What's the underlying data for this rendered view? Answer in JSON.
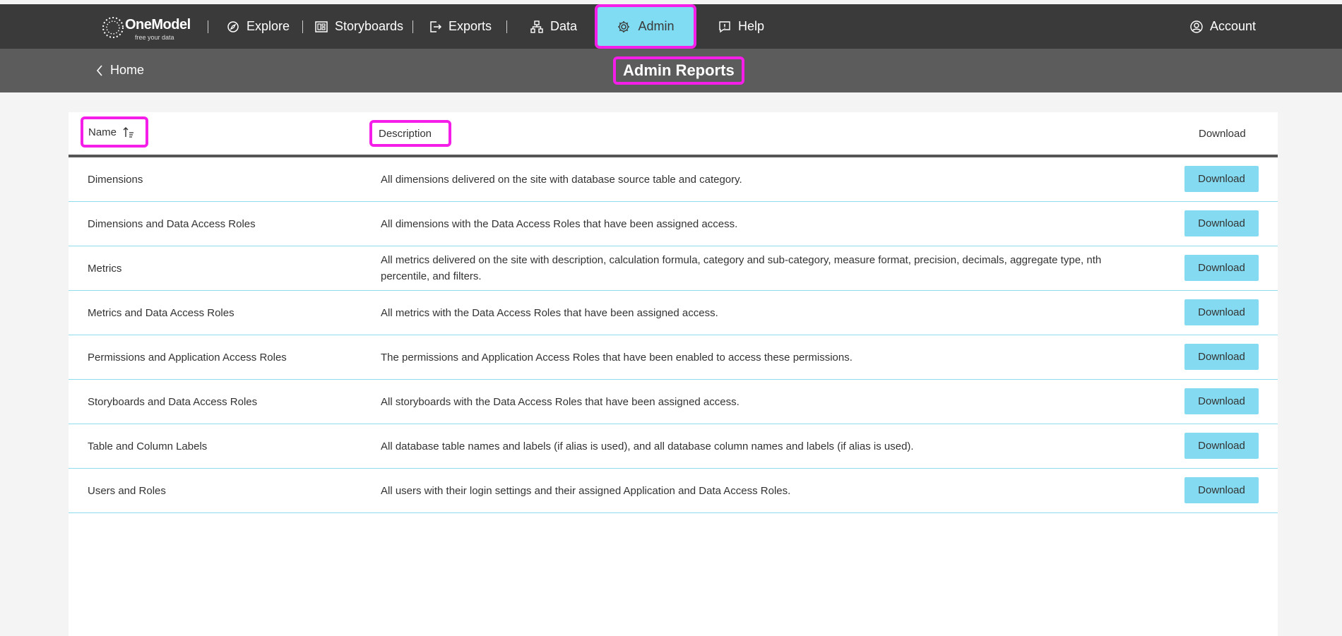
{
  "nav": {
    "logo_text": "OneModel",
    "logo_tagline": "free your data",
    "items": [
      {
        "label": "Explore"
      },
      {
        "label": "Storyboards"
      },
      {
        "label": "Exports"
      },
      {
        "label": "Data"
      },
      {
        "label": "Admin"
      },
      {
        "label": "Help"
      }
    ],
    "account_label": "Account"
  },
  "subheader": {
    "home_label": "Home",
    "title": "Admin Reports"
  },
  "table": {
    "columns": {
      "name": "Name",
      "description": "Description",
      "download": "Download"
    },
    "rows": [
      {
        "name": "Dimensions",
        "description": "All dimensions delivered on the site with database source table and category.",
        "action": "Download"
      },
      {
        "name": "Dimensions and Data Access Roles",
        "description": "All dimensions with the Data Access Roles that have been assigned access.",
        "action": "Download"
      },
      {
        "name": "Metrics",
        "description": "All metrics delivered on the site with description, calculation formula, category and sub-category, measure format, precision, decimals, aggregate type, nth percentile, and filters.",
        "action": "Download"
      },
      {
        "name": "Metrics and Data Access Roles",
        "description": "All metrics with the Data Access Roles that have been assigned access.",
        "action": "Download"
      },
      {
        "name": "Permissions and Application Access Roles",
        "description": "The permissions and Application Access Roles that have been enabled to access these permissions.",
        "action": "Download"
      },
      {
        "name": "Storyboards and Data Access Roles",
        "description": "All storyboards with the Data Access Roles that have been assigned access.",
        "action": "Download"
      },
      {
        "name": "Table and Column Labels",
        "description": "All database table names and labels (if alias is used), and all database column names and labels (if alias is used).",
        "action": "Download"
      },
      {
        "name": "Users and Roles",
        "description": "All users with their login settings and their assigned Application and Data Access Roles.",
        "action": "Download"
      }
    ]
  },
  "colors": {
    "topbar": "#3a3a3a",
    "subbar": "#5c5c5c",
    "accent": "#84dbf1",
    "highlight": "#f41ee8"
  }
}
